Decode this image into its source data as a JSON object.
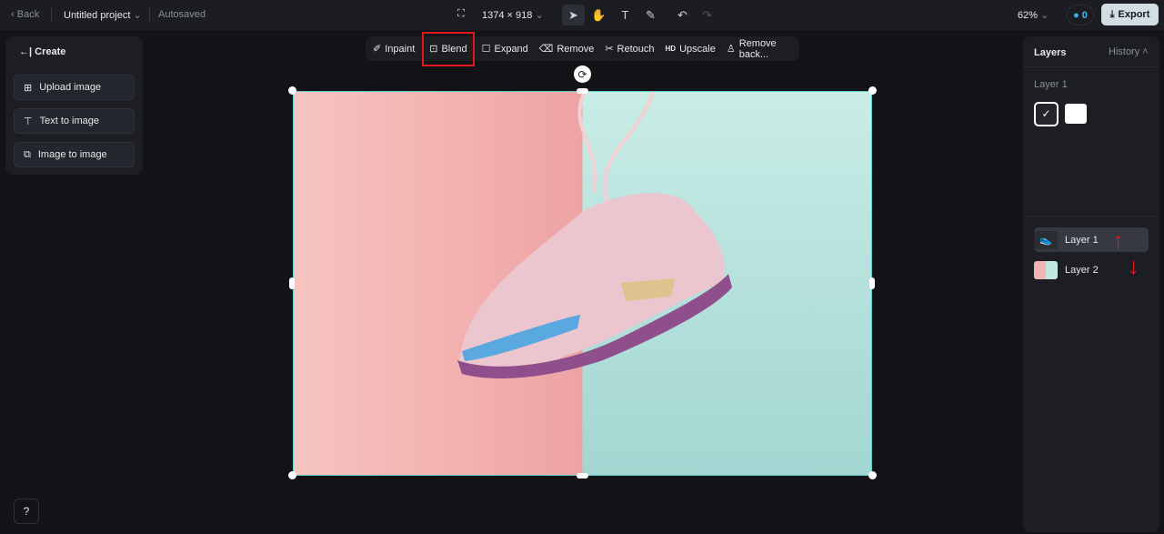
{
  "topbar": {
    "back": "Back",
    "project": "Untitled project",
    "status": "Autosaved",
    "dimensions": "1374 × 918",
    "zoom": "62%",
    "credits": "0",
    "export": "Export"
  },
  "toolbar": [
    "Inpaint",
    "Blend",
    "Expand",
    "Remove",
    "Retouch",
    "Upscale",
    "Remove back..."
  ],
  "upscale_badge": "HD",
  "create": {
    "title": "Create",
    "items": [
      "Upload image",
      "Text to image",
      "Image to image"
    ]
  },
  "layers": {
    "title": "Layers",
    "history": "History",
    "selected_layer": "Layer 1",
    "list": [
      "Layer 1",
      "Layer 2"
    ]
  },
  "colors": {
    "accent": "#5ad0c8",
    "highlight": "#e0191f"
  }
}
